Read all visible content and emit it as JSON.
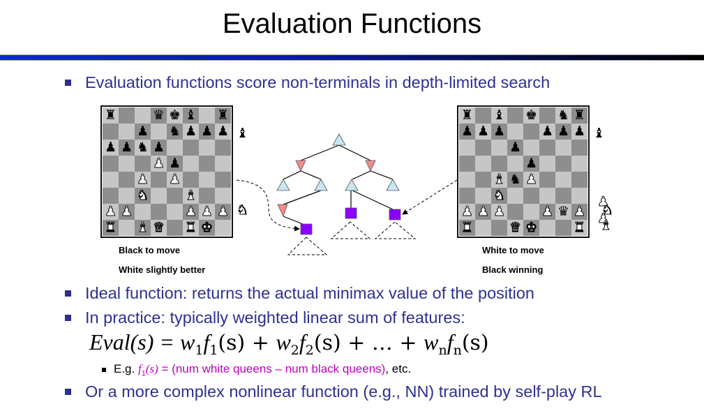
{
  "title": "Evaluation Functions",
  "bullets": [
    "Evaluation functions score non-terminals in depth-limited search",
    "Ideal function: returns the actual minimax value of the position",
    "In practice: typically weighted linear sum of features:",
    "Or a more complex nonlinear function (e.g., NN) trained by self-play RL"
  ],
  "equation": {
    "lhs": "Eval(s) = ",
    "terms": [
      "w",
      "1",
      "f",
      "1",
      "(s) + ",
      "w",
      "2",
      "f",
      "2",
      "(s) + … + ",
      "w",
      "n",
      "f",
      "n",
      "(s)"
    ]
  },
  "sub_bullet": {
    "prefix": "E.g. ",
    "feature": "f",
    "feature_sub": "1",
    "feature_arg": "(s)",
    "highlight": " = (num white queens – num black queens)",
    "suffix": ", etc."
  },
  "colors": {
    "bullet_text": "#2e3192",
    "highlight": "#c000c0",
    "max_node": "#c8e6f5",
    "min_node": "#f08c8c",
    "leaf_node": "#8b00ff"
  },
  "boards": [
    {
      "ranks": [
        "r..qkb.r",
        "..p.nppp",
        "ppnp....",
        "...Pp...",
        "..P.P...",
        "..N..B..",
        "PP...PPP",
        "R.BQ.RK."
      ],
      "captured": [
        "b",
        "N"
      ],
      "caption1": "Black to move",
      "caption2": "White slightly better"
    },
    {
      "ranks": [
        "r.b.k.nr",
        "ppp..ppp",
        "...p....",
        "....p...",
        "..BnP...",
        "..N.....",
        "PPP..PqP",
        "R..QK..R"
      ],
      "captured": [
        "b",
        "P",
        "N",
        "B"
      ],
      "caption1": "White to move",
      "caption2": "Black winning"
    }
  ]
}
